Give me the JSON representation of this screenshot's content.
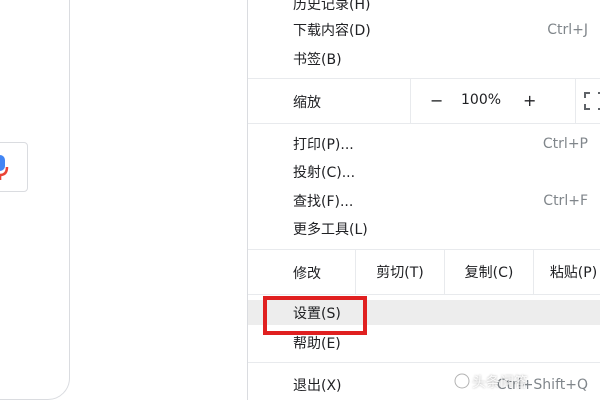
{
  "menu": {
    "history": {
      "label": "历史记录(H)"
    },
    "downloads": {
      "label": "下载内容(D)",
      "shortcut": "Ctrl+J"
    },
    "bookmarks": {
      "label": "书签(B)"
    },
    "zoom": {
      "label": "缩放",
      "minus": "−",
      "value": "100%",
      "plus": "+"
    },
    "print": {
      "label": "打印(P)...",
      "shortcut": "Ctrl+P"
    },
    "cast": {
      "label": "投射(C)..."
    },
    "find": {
      "label": "查找(F)...",
      "shortcut": "Ctrl+F"
    },
    "more_tools": {
      "label": "更多工具(L)"
    },
    "edit": {
      "label": "修改",
      "cut": "剪切(T)",
      "copy": "复制(C)",
      "paste": "粘贴(P)"
    },
    "settings": {
      "label": "设置(S)"
    },
    "help": {
      "label": "帮助(E)"
    },
    "exit": {
      "label": "退出(X)",
      "shortcut": "Ctrl+Shift+Q"
    }
  },
  "annotation": {
    "highlight_color": "#e02020"
  },
  "watermark": {
    "text": "头条问答"
  },
  "icons": {
    "mic": "microphone-icon",
    "fullscreen": "fullscreen-icon"
  }
}
